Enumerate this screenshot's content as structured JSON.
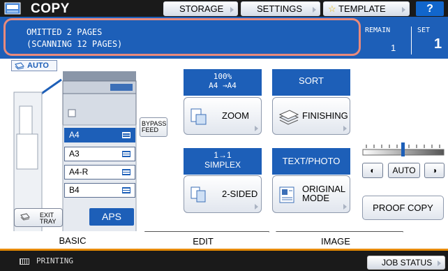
{
  "header": {
    "title": "COPY",
    "storage_label": "STORAGE",
    "settings_label": "SETTINGS",
    "template_label": "TEMPLATE",
    "help_label": "?"
  },
  "message": {
    "line1": "OMITTED 2 PAGES",
    "line2": "(SCANNING 12 PAGES)",
    "remain_label": "REMAIN",
    "remain_value": "1",
    "set_label": "SET",
    "set_value": "1"
  },
  "paper": {
    "auto_label": "AUTO",
    "trays": [
      "A4",
      "A3",
      "A4-R",
      "B4"
    ],
    "selected_tray": "A4",
    "bypass_line1": "BYPASS",
    "bypass_line2": "FEED",
    "exit_line1": "EXIT",
    "exit_line2": "TRAY",
    "aps_label": "APS"
  },
  "zoom": {
    "info_line1": "100%",
    "info_line2": "A4 →A4",
    "button_label": "ZOOM"
  },
  "finishing": {
    "info": "SORT",
    "button_label": "FINISHING"
  },
  "sided": {
    "info_line1": "1→1",
    "info_line2": "SIMPLEX",
    "button_label": "2-SIDED"
  },
  "original_mode": {
    "info": "TEXT/PHOTO",
    "button_line1": "ORIGINAL",
    "button_line2": "MODE"
  },
  "density": {
    "auto_label": "AUTO",
    "level": 0.5
  },
  "proof_copy_label": "PROOF COPY",
  "tabs": [
    {
      "label": "BASIC",
      "active": true
    },
    {
      "label": "EDIT",
      "active": false
    },
    {
      "label": "IMAGE",
      "active": false
    }
  ],
  "status": {
    "text": "PRINTING",
    "job_status_label": "JOB STATUS"
  },
  "colors": {
    "accent_blue": "#1d5fb8",
    "highlight_border": "#e98a7c",
    "tab_accent": "#e68a00"
  }
}
